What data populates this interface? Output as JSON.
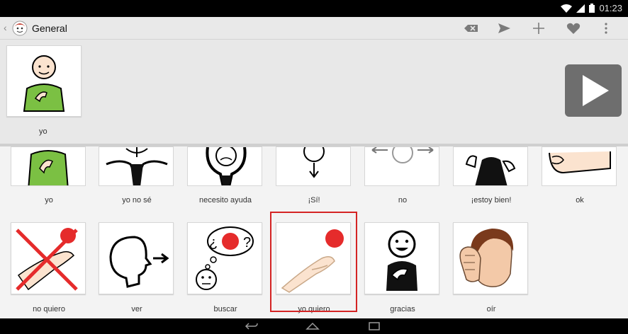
{
  "status": {
    "time": "01:23",
    "icons": [
      "wifi-icon",
      "signal-icon",
      "battery-icon"
    ]
  },
  "actionbar": {
    "title": "General",
    "actions": [
      "backspace-icon",
      "send-icon",
      "add-icon",
      "favorite-icon",
      "overflow-menu-icon"
    ]
  },
  "sentence": {
    "items": [
      {
        "label": "yo"
      }
    ]
  },
  "grid": {
    "row1": [
      {
        "label": "yo"
      },
      {
        "label": "yo no sé"
      },
      {
        "label": "necesito ayuda"
      },
      {
        "label": "¡Sí!"
      },
      {
        "label": "no"
      },
      {
        "label": "¡estoy bien!"
      },
      {
        "label": "ok"
      }
    ],
    "row2": [
      {
        "label": "no quiero"
      },
      {
        "label": "ver"
      },
      {
        "label": "buscar"
      },
      {
        "label": "yo quiero",
        "selected": true
      },
      {
        "label": "gracias"
      },
      {
        "label": "oír"
      }
    ]
  },
  "colors": {
    "accent_red": "#e52b2b",
    "highlight": "#d42424",
    "play_bg": "#6e6e6e"
  }
}
